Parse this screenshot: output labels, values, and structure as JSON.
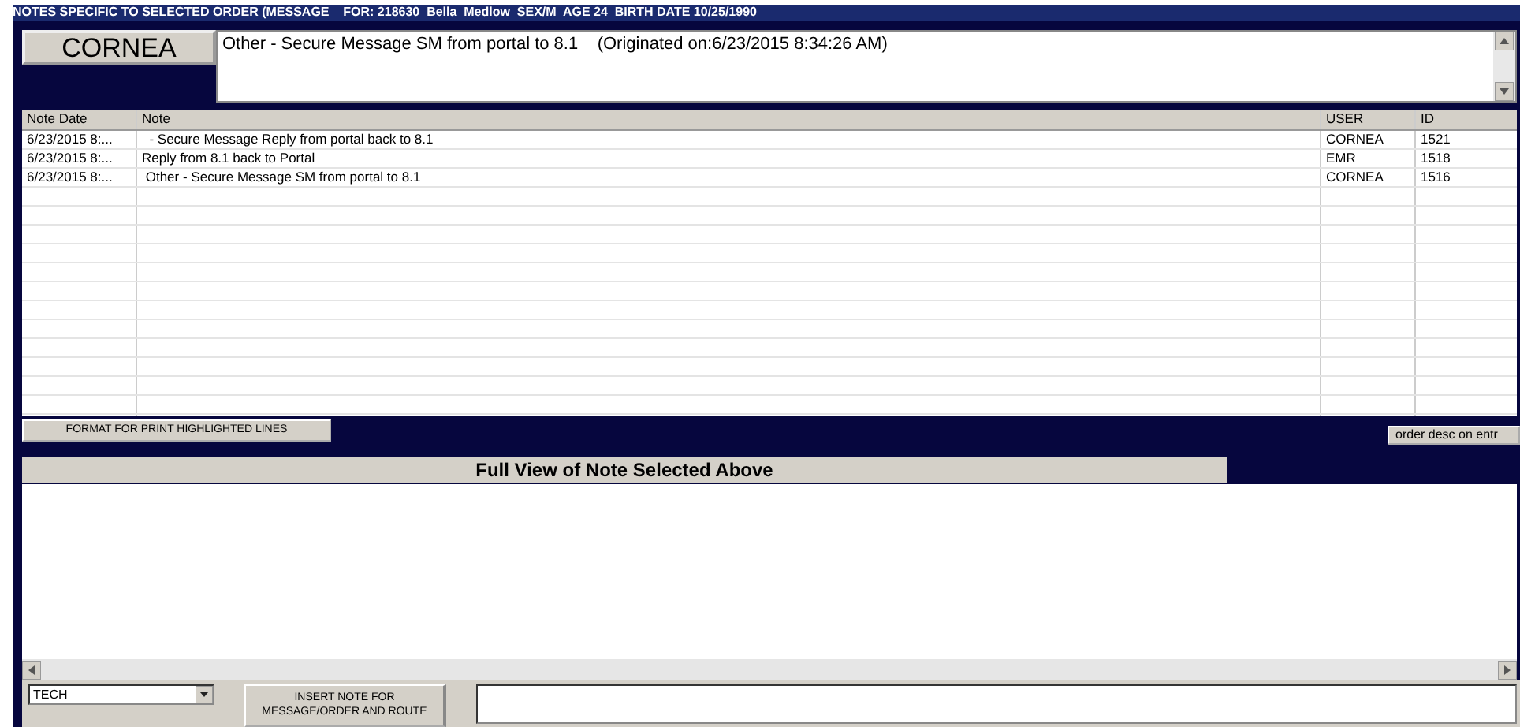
{
  "header": {
    "title": "NOTES SPECIFIC TO SELECTED ORDER (MESSAGE    FOR: 218630  Bella  Medlow  SEX/M  AGE 24  BIRTH DATE 10/25/1990"
  },
  "user_button": "CORNEA",
  "current_note": "Other - Secure Message SM from portal to 8.1    (Originated on:6/23/2015 8:34:26 AM)",
  "table": {
    "columns": [
      "Note Date",
      "Note",
      "USER",
      "ID"
    ],
    "rows": [
      {
        "date": "6/23/2015 8:...",
        "note": "  - Secure Message Reply from portal back to 8.1",
        "user": "CORNEA",
        "id": "1521"
      },
      {
        "date": "6/23/2015 8:...",
        "note": "Reply from 8.1 back to Portal",
        "user": "EMR",
        "id": "1518"
      },
      {
        "date": "6/23/2015 8:...",
        "note": " Other - Secure Message SM from portal to 8.1",
        "user": "CORNEA",
        "id": "1516"
      }
    ]
  },
  "format_button": "FORMAT FOR PRINT HIGHLIGHTED LINES",
  "order_button": "order desc on entr",
  "full_view_title": "Full View of Note Selected Above",
  "footer": {
    "role_select": "TECH",
    "insert_button": "INSERT NOTE FOR MESSAGE/ORDER AND ROUTE"
  }
}
